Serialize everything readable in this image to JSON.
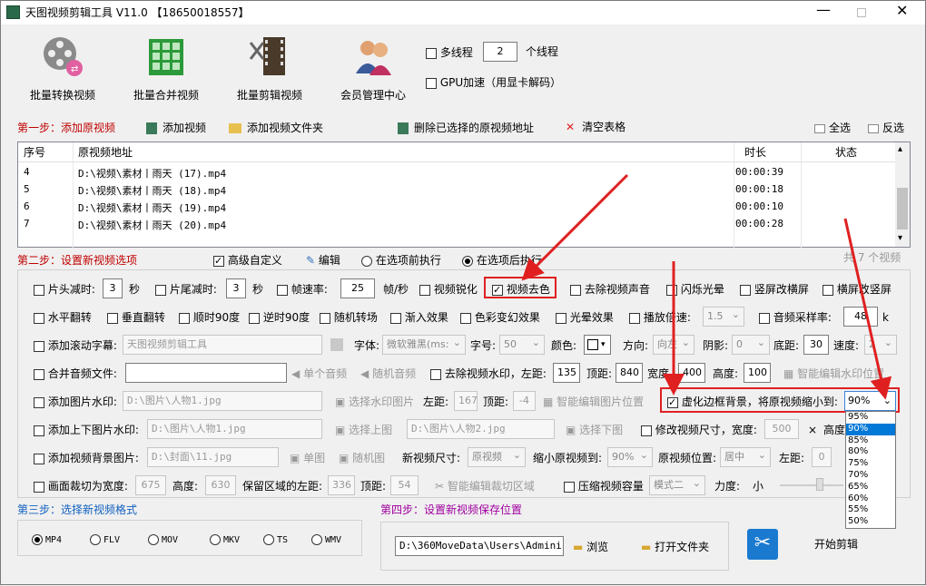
{
  "window": {
    "title": "天图视频剪辑工具 V11.0 【18650018557】"
  },
  "toolbar": {
    "convert": "批量转换视频",
    "merge": "批量合并视频",
    "clip": "批量剪辑视频",
    "member": "会员管理中心",
    "multithread": "多线程",
    "threads": "2",
    "threads_unit": "个线程",
    "gpu": "GPU加速（用显卡解码）"
  },
  "step1": {
    "title": "第一步：添加原视频",
    "add_video": "添加视频",
    "add_folder": "添加视频文件夹",
    "delete_sel": "删除已选择的原视频地址",
    "clear": "清空表格",
    "select_all": "全选",
    "invert": "反选"
  },
  "table": {
    "headers": [
      "序号",
      "原视频地址",
      "时长",
      "状态"
    ],
    "rows": [
      {
        "no": "4",
        "path": "D:\\视频\\素材丨雨天 (17).mp4",
        "dur": "00:00:39"
      },
      {
        "no": "5",
        "path": "D:\\视频\\素材丨雨天 (18).mp4",
        "dur": "00:00:18"
      },
      {
        "no": "6",
        "path": "D:\\视频\\素材丨雨天 (19).mp4",
        "dur": "00:00:10"
      },
      {
        "no": "7",
        "path": "D:\\视频\\素材丨雨天 (20).mp4",
        "dur": "00:00:28"
      }
    ],
    "count": "共 7 个视频"
  },
  "step2": {
    "title": "第二步：设置新视频选项",
    "advanced": "高级自定义",
    "edit": "编辑",
    "before": "在选项前执行",
    "after": "在选项后执行"
  },
  "opts": {
    "head_cut": "片头减时:",
    "head_val": "3",
    "sec": "秒",
    "tail_cut": "片尾减时:",
    "tail_val": "3",
    "sec2": "秒",
    "fps": "帧速率:",
    "fps_val": "25",
    "fps_unit": "帧/秒",
    "sharpen": "视频锐化",
    "decolor": "视频去色",
    "remove_audio": "去除视频声音",
    "flash": "闪烁光晕",
    "v2h": "竖屏改横屏",
    "h2v": "横屏改竖屏",
    "hflip": "水平翻转",
    "vflip": "垂直翻转",
    "rot90": "顺时90度",
    "rot_90": "逆时90度",
    "random_trans": "随机转场",
    "fade_in": "渐入效果",
    "color_fx": "色彩变幻效果",
    "light_fx": "光晕效果",
    "speed": "播放倍速:",
    "speed_val": "1.5",
    "sample": "音频采样率:",
    "sample_val": "48",
    "sample_unit": "k",
    "scroll": "添加滚动字幕:",
    "scroll_text": "天图视频剪辑工具",
    "font": "字体:",
    "font_val": "微软雅黑(ms:",
    "size": "字号:",
    "size_val": "50",
    "color": "颜色:",
    "dir": "方向:",
    "dir_val": "向左",
    "shadow": "阴影:",
    "shadow_val": "0",
    "bottom": "底距:",
    "bottom_val": "30",
    "speed2": "速度:",
    "speed2_val": "2",
    "merge_audio": "合并音频文件:",
    "single_audio": "单个音频",
    "random_audio": "随机音频",
    "remove_wm": "去除视频水印，左距:",
    "wm_left": "135",
    "wm_top_lbl": "顶距:",
    "wm_top": "840",
    "wm_w_lbl": "宽度",
    "wm_w": "400",
    "wm_h_lbl": "高度:",
    "wm_h": "100",
    "smart_wm": "智能编辑水印位置",
    "img_wm": "添加图片水印:",
    "img_wm_path": "D:\\图片\\人物1.jpg",
    "choose_wm": "选择水印图片",
    "left": "左距:",
    "left_val": "1675",
    "top": "顶距:",
    "top_val": "-4",
    "smart_img": "智能编辑图片位置",
    "blur_bg": "虚化边框背景，将原视频缩小到:",
    "blur_val": "90%",
    "tb_img": "添加上下图片水印:",
    "top_img": "D:\\图片\\人物1.jpg",
    "choose_top": "选择上图",
    "bottom_img": "D:\\图片\\人物2.jpg",
    "choose_bottom": "选择下图",
    "resize": "修改视频尺寸，宽度:",
    "resize_w": "500",
    "times": "×",
    "height_lbl": "高度",
    "bg_img": "添加视频背景图片:",
    "bg_path": "D:\\封面\\11.jpg",
    "single_img": "单图",
    "random_img": "随机图",
    "new_size": "新视频尺寸:",
    "new_size_val": "原视频",
    "shrink": "缩小原视频到:",
    "shrink_val": "90%",
    "pos": "原视频位置:",
    "pos_val": "居中",
    "left2": "左距:",
    "left2_val": "0",
    "crop": "画面裁切为宽度:",
    "crop_w": "675",
    "crop_h_lbl": "高度:",
    "crop_h": "630",
    "keep_left": "保留区域的左距:",
    "keep_left_val": "336",
    "keep_top": "顶距:",
    "keep_top_val": "54",
    "smart_crop": "智能编辑裁切区域",
    "compress": "压缩视频容量",
    "mode": "模式二",
    "strength": "力度:",
    "small": "小"
  },
  "dropdown": {
    "items": [
      "95%",
      "90%",
      "85%",
      "80%",
      "75%",
      "70%",
      "65%",
      "60%",
      "55%",
      "50%"
    ],
    "selected": "90%"
  },
  "step3": {
    "title": "第三步：选择新视频格式",
    "formats": [
      "MP4",
      "FLV",
      "MOV",
      "MKV",
      "TS",
      "WMV"
    ]
  },
  "step4": {
    "title": "第四步：设置新视频保存位置",
    "path": "D:\\360MoveData\\Users\\Administr",
    "browse": "浏览",
    "open": "打开文件夹",
    "start": "开始剪辑"
  }
}
